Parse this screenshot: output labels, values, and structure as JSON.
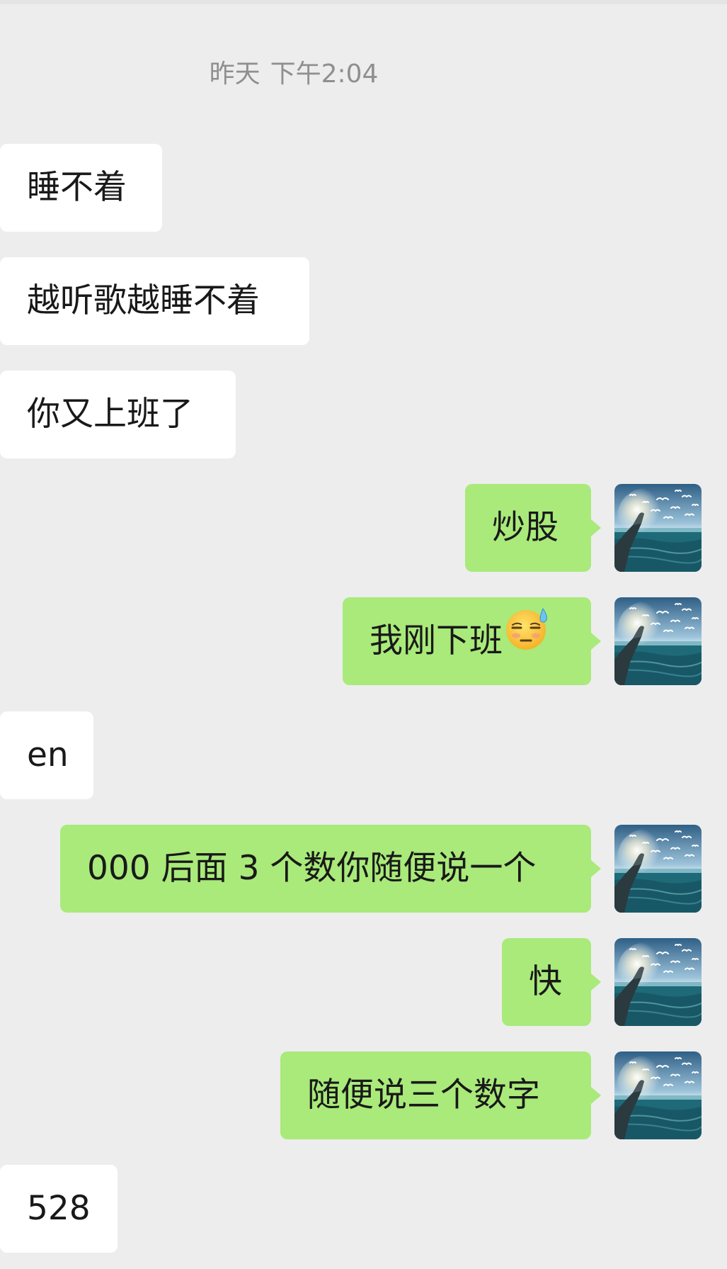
{
  "chat": {
    "timestamp_day": "昨天",
    "timestamp_time": "下午2:04",
    "messages": [
      {
        "from": "other",
        "text": "睡不着"
      },
      {
        "from": "other",
        "text": "越听歌越睡不着"
      },
      {
        "from": "other",
        "text": "你又上班了"
      },
      {
        "from": "self",
        "text": "炒股"
      },
      {
        "from": "self",
        "text": "我刚下班",
        "emoji": "sweat-face-emoji"
      },
      {
        "from": "other",
        "text": "en"
      },
      {
        "from": "self",
        "text": "000 后面 3 个数你随便说一个"
      },
      {
        "from": "self",
        "text": "快"
      },
      {
        "from": "self",
        "text": "随便说三个数字"
      },
      {
        "from": "other",
        "text": "528"
      }
    ]
  },
  "colors": {
    "background": "#ededed",
    "incoming_bubble": "#ffffff",
    "outgoing_bubble": "#a9ea7a",
    "timestamp_text": "#8f8f8f"
  },
  "icons": {
    "self_avatar": "seagull-ocean-avatar-icon"
  }
}
